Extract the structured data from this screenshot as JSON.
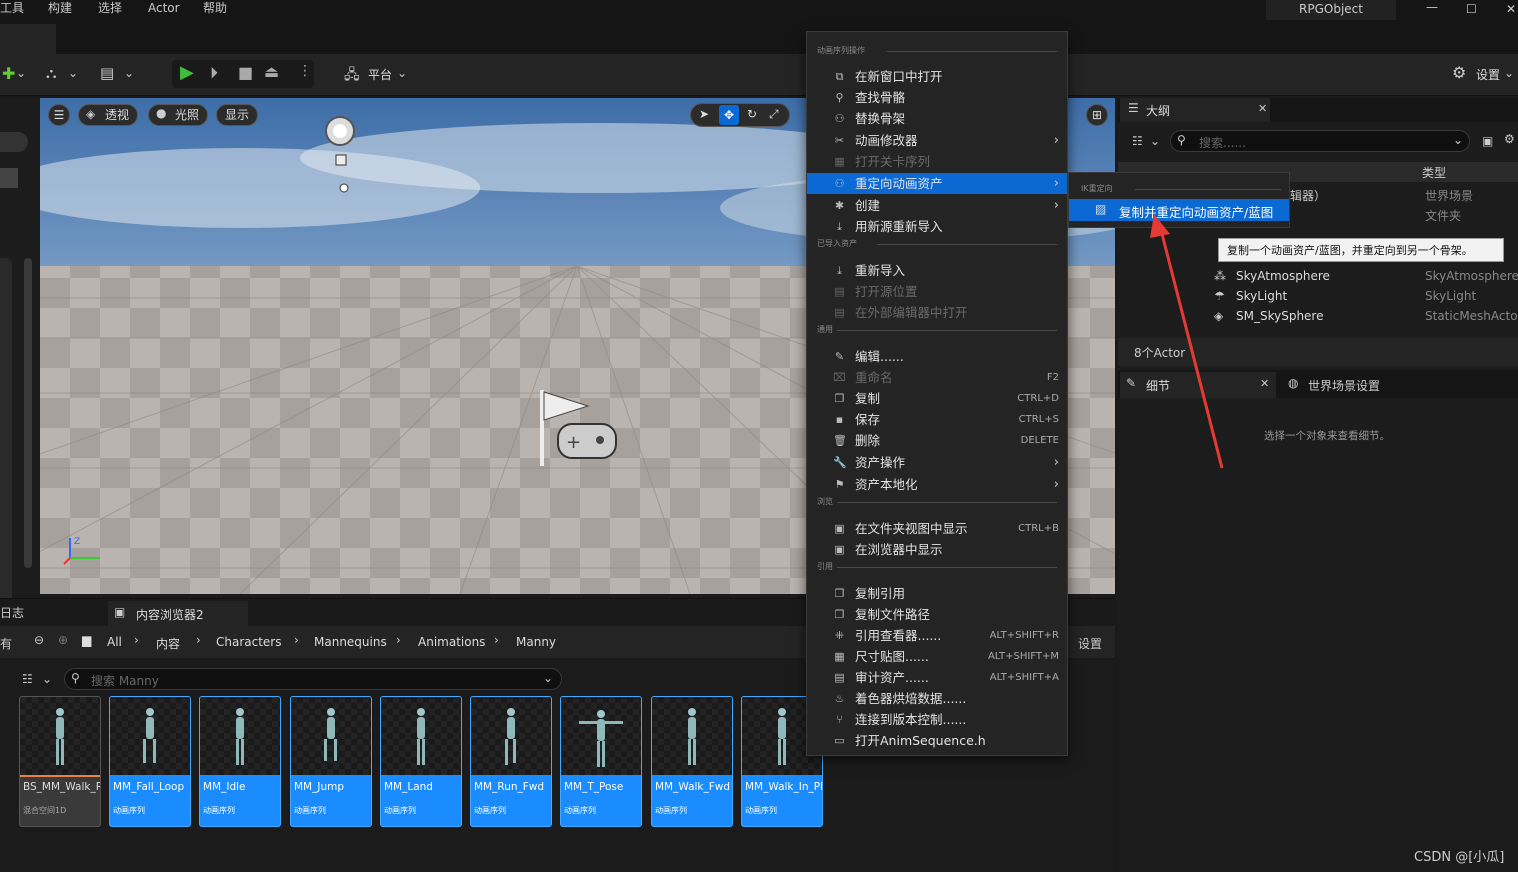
{
  "menubar": {
    "items": [
      "工具",
      "构建",
      "选择",
      "Actor",
      "帮助"
    ],
    "project": "RPGObject",
    "min": "—",
    "max": "☐",
    "close": "✕"
  },
  "toolbar": {
    "platform": "平台",
    "settings": "设置"
  },
  "viewport": {
    "perspective": "透视",
    "lighting": "光照",
    "show": "显示"
  },
  "context_menu": {
    "sections": [
      {
        "header": "动画序列操作",
        "items": [
          {
            "label": "在新窗口中打开",
            "icon": "open-window-icon",
            "shortcut": "",
            "arrow": false,
            "disabled": false
          },
          {
            "label": "查找骨骼",
            "icon": "find-skeleton-icon",
            "shortcut": "",
            "arrow": false,
            "disabled": false
          },
          {
            "label": "替换骨架",
            "icon": "replace-skeleton-icon",
            "shortcut": "",
            "arrow": false,
            "disabled": false
          },
          {
            "label": "动画修改器",
            "icon": "anim-modifier-icon",
            "shortcut": "",
            "arrow": true,
            "disabled": false
          },
          {
            "label": "打开关卡序列",
            "icon": "level-sequence-icon",
            "shortcut": "",
            "arrow": false,
            "disabled": true
          },
          {
            "label": "重定向动画资产",
            "icon": "retarget-icon",
            "shortcut": "",
            "arrow": true,
            "disabled": false,
            "highlight": true
          },
          {
            "label": "创建",
            "icon": "create-icon",
            "shortcut": "",
            "arrow": true,
            "disabled": false
          },
          {
            "label": "用新源重新导入",
            "icon": "reimport-new-icon",
            "shortcut": "",
            "arrow": false,
            "disabled": false
          }
        ]
      },
      {
        "header": "已导入资产",
        "items": [
          {
            "label": "重新导入",
            "icon": "reimport-icon",
            "shortcut": "",
            "arrow": false,
            "disabled": false
          },
          {
            "label": "打开源位置",
            "icon": "source-location-icon",
            "shortcut": "",
            "arrow": false,
            "disabled": true
          },
          {
            "label": "在外部编辑器中打开",
            "icon": "external-editor-icon",
            "shortcut": "",
            "arrow": false,
            "disabled": true
          }
        ]
      },
      {
        "header": "通用",
        "items": [
          {
            "label": "编辑......",
            "icon": "edit-icon",
            "shortcut": "",
            "arrow": false,
            "disabled": false
          },
          {
            "label": "重命名",
            "icon": "rename-icon",
            "shortcut": "F2",
            "arrow": false,
            "disabled": true
          },
          {
            "label": "复制",
            "icon": "duplicate-icon",
            "shortcut": "CTRL+D",
            "arrow": false,
            "disabled": false
          },
          {
            "label": "保存",
            "icon": "save-icon",
            "shortcut": "CTRL+S",
            "arrow": false,
            "disabled": false
          },
          {
            "label": "删除",
            "icon": "delete-icon",
            "shortcut": "DELETE",
            "arrow": false,
            "disabled": false
          },
          {
            "label": "资产操作",
            "icon": "asset-actions-icon",
            "shortcut": "",
            "arrow": true,
            "disabled": false
          },
          {
            "label": "资产本地化",
            "icon": "localization-icon",
            "shortcut": "",
            "arrow": true,
            "disabled": false
          }
        ]
      },
      {
        "header": "浏览",
        "items": [
          {
            "label": "在文件夹视图中显示",
            "icon": "folder-view-icon",
            "shortcut": "CTRL+B",
            "arrow": false,
            "disabled": false
          },
          {
            "label": "在浏览器中显示",
            "icon": "browser-icon",
            "shortcut": "",
            "arrow": false,
            "disabled": false
          }
        ]
      },
      {
        "header": "引用",
        "items": [
          {
            "label": "复制引用",
            "icon": "copy-reference-icon",
            "shortcut": "",
            "arrow": false,
            "disabled": false
          },
          {
            "label": "复制文件路径",
            "icon": "copy-path-icon",
            "shortcut": "",
            "arrow": false,
            "disabled": false
          },
          {
            "label": "引用查看器......",
            "icon": "reference-viewer-icon",
            "shortcut": "ALT+SHIFT+R",
            "arrow": false,
            "disabled": false
          },
          {
            "label": "尺寸贴图......",
            "icon": "size-map-icon",
            "shortcut": "ALT+SHIFT+M",
            "arrow": false,
            "disabled": false
          },
          {
            "label": "审计资产......",
            "icon": "audit-icon",
            "shortcut": "ALT+SHIFT+A",
            "arrow": false,
            "disabled": false
          },
          {
            "label": "着色器烘焙数据......",
            "icon": "shader-icon",
            "shortcut": "",
            "arrow": false,
            "disabled": false
          },
          {
            "label": "连接到版本控制......",
            "icon": "source-control-icon",
            "shortcut": "",
            "arrow": false,
            "disabled": false
          },
          {
            "label": "打开AnimSequence.h",
            "icon": "header-file-icon",
            "shortcut": "",
            "arrow": false,
            "disabled": false
          }
        ]
      }
    ]
  },
  "submenu": {
    "header": "IK重定向",
    "item": "复制并重定向动画资产/蓝图"
  },
  "tooltip": "复制一个动画资产/蓝图，并重定向到另一个骨架。",
  "outliner": {
    "title": "大纲",
    "search_placeholder": "搜索......",
    "col_type": "类型",
    "rows": [
      {
        "name": "辑器）",
        "type": "世界场景"
      },
      {
        "name": "",
        "type": "文件夹"
      },
      {
        "name": "SkyAtmosphere",
        "type": "SkyAtmosphere"
      },
      {
        "name": "SkyLight",
        "type": "SkyLight"
      },
      {
        "name": "SM_SkySphere",
        "type": "StaticMeshActo"
      }
    ],
    "count": "8个Actor"
  },
  "details": {
    "tab": "细节",
    "world_settings": "世界场景设置",
    "empty": "选择一个对象来查看细节。"
  },
  "content_browser": {
    "log_tab": "日志",
    "title": "内容浏览器2",
    "crumbs": [
      "All",
      "内容",
      "Characters",
      "Mannequins",
      "Animations",
      "Manny"
    ],
    "settings": "设置",
    "search_placeholder": "搜索 Manny",
    "left_label": "有"
  },
  "assets": [
    {
      "name": "BS_MM_Walk_Run",
      "type": "混合空间1D",
      "selected": true
    },
    {
      "name": "MM_Fall_Loop",
      "type": "动画序列"
    },
    {
      "name": "MM_Idle",
      "type": "动画序列"
    },
    {
      "name": "MM_Jump",
      "type": "动画序列"
    },
    {
      "name": "MM_Land",
      "type": "动画序列"
    },
    {
      "name": "MM_Run_Fwd",
      "type": "动画序列"
    },
    {
      "name": "MM_T_Pose",
      "type": "动画序列"
    },
    {
      "name": "MM_Walk_Fwd",
      "type": "动画序列"
    },
    {
      "name": "MM_Walk_In_Place",
      "type": "动画序列"
    }
  ],
  "watermark": "CSDN @[小瓜]",
  "colors": {
    "highlight": "#0b69d4",
    "asset_blue": "#1a8cff",
    "annotation_red": "#e53935"
  }
}
